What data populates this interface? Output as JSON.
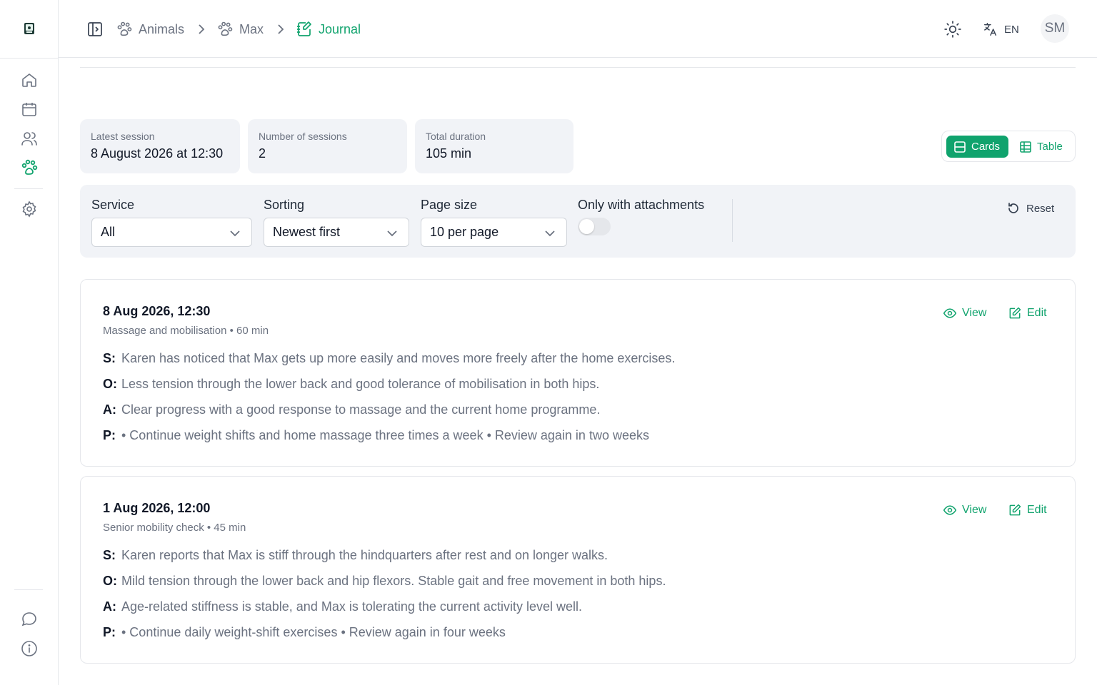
{
  "breadcrumb": {
    "items": [
      {
        "label": "Animals"
      },
      {
        "label": "Max"
      },
      {
        "label": "Journal"
      }
    ]
  },
  "header": {
    "language": "EN",
    "avatar_initials": "SM"
  },
  "stats": [
    {
      "label": "Latest session",
      "value": "8 August 2026 at 12:30"
    },
    {
      "label": "Number of sessions",
      "value": "2"
    },
    {
      "label": "Total duration",
      "value": "105 min"
    }
  ],
  "view_toggle": {
    "cards_label": "Cards",
    "table_label": "Table",
    "selected": "Cards"
  },
  "filters": {
    "service": {
      "label": "Service",
      "value": "All"
    },
    "sorting": {
      "label": "Sorting",
      "value": "Newest first"
    },
    "page_size": {
      "label": "Page size",
      "value": "10 per page"
    },
    "attachments": {
      "label": "Only with attachments",
      "on": false
    },
    "reset_label": "Reset"
  },
  "sessions": [
    {
      "date": "8 Aug 2026, 12:30",
      "subtitle": "Massage and mobilisation • 60 min",
      "view_label": "View",
      "edit_label": "Edit",
      "soap": [
        {
          "key": "S:",
          "text": "Karen has noticed that Max gets up more easily and moves more freely after the home exercises."
        },
        {
          "key": "O:",
          "text": "Less tension through the lower back and good tolerance of mobilisation in both hips."
        },
        {
          "key": "A:",
          "text": "Clear progress with a good response to massage and the current home programme."
        },
        {
          "key": "P:",
          "text": "• Continue weight shifts and home massage three times a week • Review again in two weeks"
        }
      ]
    },
    {
      "date": "1 Aug 2026, 12:00",
      "subtitle": "Senior mobility check • 45 min",
      "view_label": "View",
      "edit_label": "Edit",
      "soap": [
        {
          "key": "S:",
          "text": "Karen reports that Max is stiff through the hindquarters after rest and on longer walks."
        },
        {
          "key": "O:",
          "text": "Mild tension through the lower back and hip flexors. Stable gait and free movement in both hips."
        },
        {
          "key": "A:",
          "text": "Age-related stiffness is stable, and Max is tolerating the current activity level well."
        },
        {
          "key": "P:",
          "text": "• Continue daily weight-shift exercises • Review again in four weeks"
        }
      ]
    }
  ],
  "colors": {
    "accent": "#10a36d",
    "muted_text": "#6b7280",
    "panel_bg": "#f1f3f7",
    "border": "#e5e7eb"
  },
  "icons": {
    "sidebar": [
      "app-logo-icon",
      "home-icon",
      "calendar-icon",
      "users-icon",
      "paw-icon",
      "gear-icon",
      "chat-icon",
      "info-icon"
    ],
    "header": [
      "sidebar-toggle-icon",
      "paw-icon",
      "journal-icon",
      "sun-icon",
      "translate-icon"
    ],
    "actions": [
      "eye-icon",
      "edit-icon",
      "reset-icon",
      "chevron-down-icon"
    ]
  }
}
